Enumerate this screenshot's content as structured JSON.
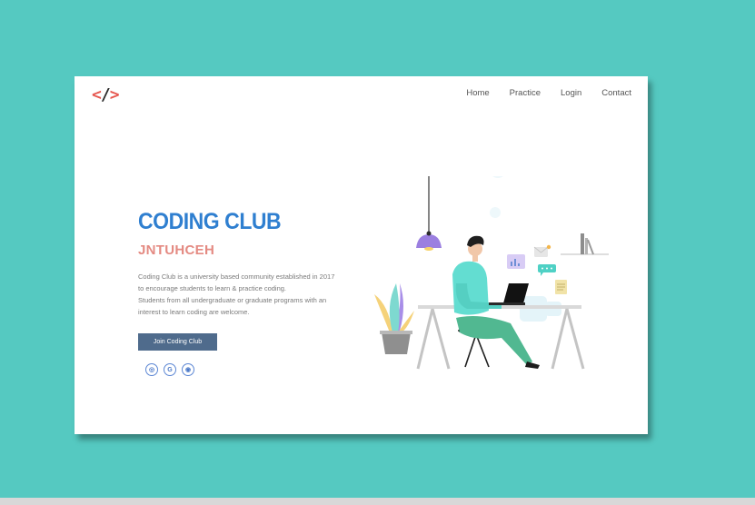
{
  "header": {
    "logo": {
      "left": "<",
      "slash": "/",
      "right": ">"
    },
    "nav": [
      "Home",
      "Practice",
      "Login",
      "Contact"
    ]
  },
  "hero": {
    "title": "CODING CLUB",
    "subtitle": "JNTUHCEH",
    "description": [
      "Coding Club is a university based community established in 2017",
      "to encourage students to learn & practice coding.",
      "Students from all undergraduate or graduate programs with an",
      "interest to learn coding are welcome."
    ],
    "join_button": "Join Coding Club"
  },
  "socials": [
    {
      "icon": "instagram-icon",
      "glyph": "◎"
    },
    {
      "icon": "google-icon",
      "glyph": "G"
    },
    {
      "icon": "github-icon",
      "glyph": "◉"
    }
  ],
  "colors": {
    "background": "#55c9c1",
    "title": "#2f7fd0",
    "subtitle": "#e48a82",
    "button": "#4f6b8c",
    "logo": "#e6574f"
  }
}
